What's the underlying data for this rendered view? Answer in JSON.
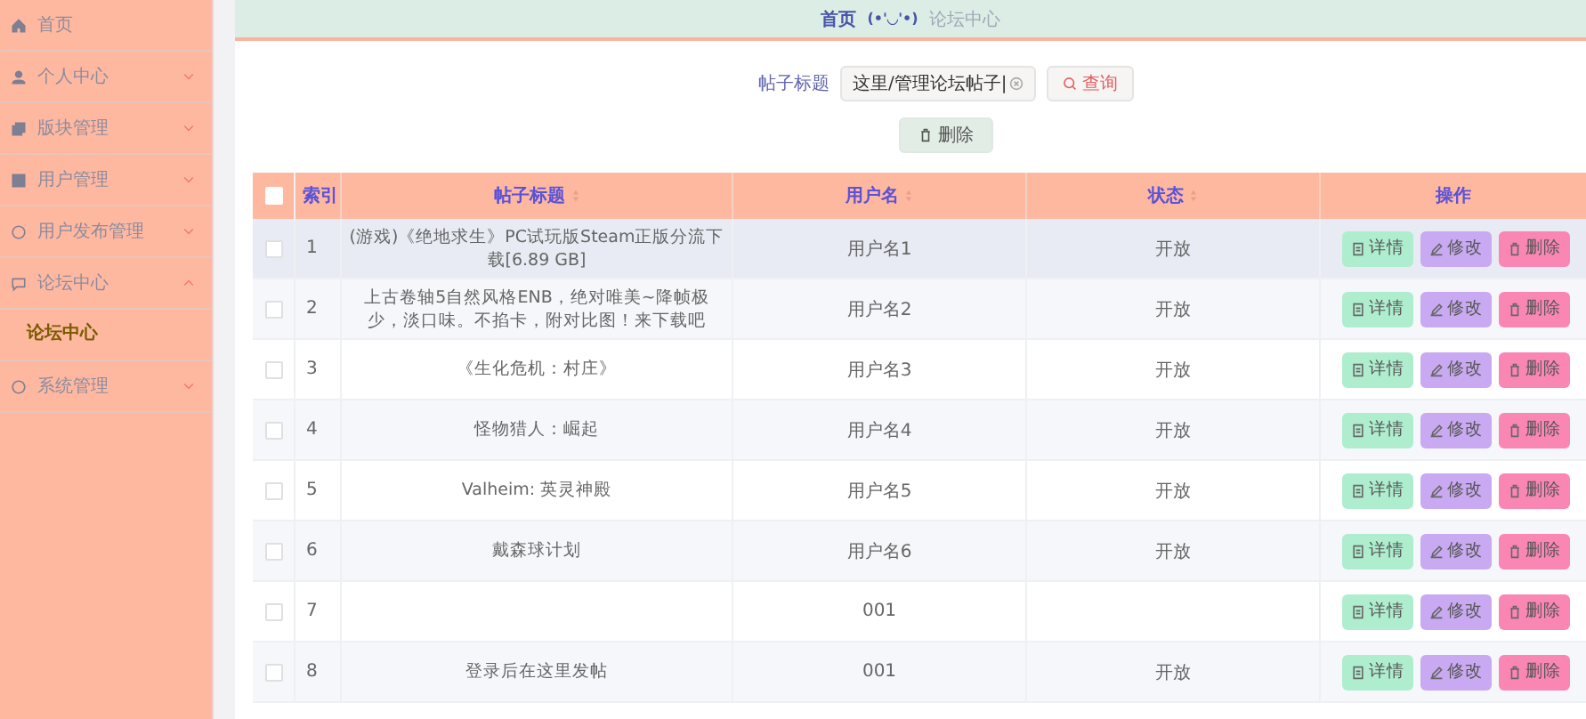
{
  "sidebar": {
    "items": [
      {
        "label": "首页"
      },
      {
        "label": "个人中心",
        "expanded": false
      },
      {
        "label": "版块管理",
        "expanded": false
      },
      {
        "label": "用户管理",
        "expanded": false
      },
      {
        "label": "用户发布管理",
        "expanded": false
      },
      {
        "label": "论坛中心",
        "expanded": true,
        "children": [
          {
            "label": "论坛中心",
            "selected": true
          }
        ]
      },
      {
        "label": "系统管理",
        "expanded": false
      }
    ]
  },
  "breadcrumb": {
    "items": [
      "首页",
      "论坛中心"
    ],
    "separator": "(•'◡'•)"
  },
  "search": {
    "label": "帖子标题",
    "value": "这里/管理论坛帖子|",
    "button": "查询"
  },
  "delete_button": "删除",
  "table": {
    "columns": [
      "索引",
      "帖子标题",
      "用户名",
      "状态",
      "操作"
    ],
    "all_checked": false,
    "rows": [
      {
        "index": "1",
        "title": "(游戏)《绝地求生》PC试玩版Steam正版分流下载[6.89 GB]",
        "user": "用户名1",
        "status": "开放",
        "hovered": true,
        "checked": false,
        "actions": [
          {
            "kind": "detail",
            "label": "详情"
          },
          {
            "kind": "edit",
            "label": "修改"
          },
          {
            "kind": "delete",
            "label": "删除"
          }
        ]
      },
      {
        "index": "2",
        "title": "上古卷轴5自然风格ENB，绝对唯美~降帧极少，淡口味。不掐卡，附对比图！来下载吧",
        "user": "用户名2",
        "status": "开放",
        "checked": false,
        "actions": [
          {
            "kind": "detail",
            "label": "详情"
          },
          {
            "kind": "edit",
            "label": "修改"
          },
          {
            "kind": "delete",
            "label": "删除"
          }
        ]
      },
      {
        "index": "3",
        "title": "《生化危机：村庄》",
        "user": "用户名3",
        "status": "开放",
        "checked": false,
        "actions": [
          {
            "kind": "detail",
            "label": "详情"
          },
          {
            "kind": "edit",
            "label": "修改"
          },
          {
            "kind": "delete",
            "label": "删除"
          }
        ]
      },
      {
        "index": "4",
        "title": "怪物猎人：崛起",
        "user": "用户名4",
        "status": "开放",
        "checked": false,
        "actions": [
          {
            "kind": "detail",
            "label": "详情"
          },
          {
            "kind": "edit",
            "label": "修改"
          },
          {
            "kind": "delete",
            "label": "删除"
          }
        ]
      },
      {
        "index": "5",
        "title": "Valheim: 英灵神殿",
        "user": "用户名5",
        "status": "开放",
        "checked": false,
        "actions": [
          {
            "kind": "detail",
            "label": "详情"
          },
          {
            "kind": "edit",
            "label": "修改"
          },
          {
            "kind": "delete",
            "label": "删除"
          }
        ]
      },
      {
        "index": "6",
        "title": "戴森球计划",
        "user": "用户名6",
        "status": "开放",
        "checked": false,
        "actions": [
          {
            "kind": "detail",
            "label": "详情"
          },
          {
            "kind": "edit",
            "label": "修改"
          },
          {
            "kind": "delete",
            "label": "删除"
          }
        ]
      },
      {
        "index": "7",
        "user": "001",
        "checked": false,
        "actions": [
          {
            "kind": "detail",
            "label": "详情"
          },
          {
            "kind": "edit",
            "label": "修改"
          },
          {
            "kind": "delete",
            "label": "删除"
          }
        ]
      },
      {
        "index": "8",
        "title": "登录后在这里发帖",
        "user": "001",
        "status": "开放",
        "checked": false,
        "actions": [
          {
            "kind": "detail",
            "label": "详情"
          },
          {
            "kind": "edit",
            "label": "修改"
          },
          {
            "kind": "delete",
            "label": "删除"
          }
        ]
      }
    ]
  }
}
